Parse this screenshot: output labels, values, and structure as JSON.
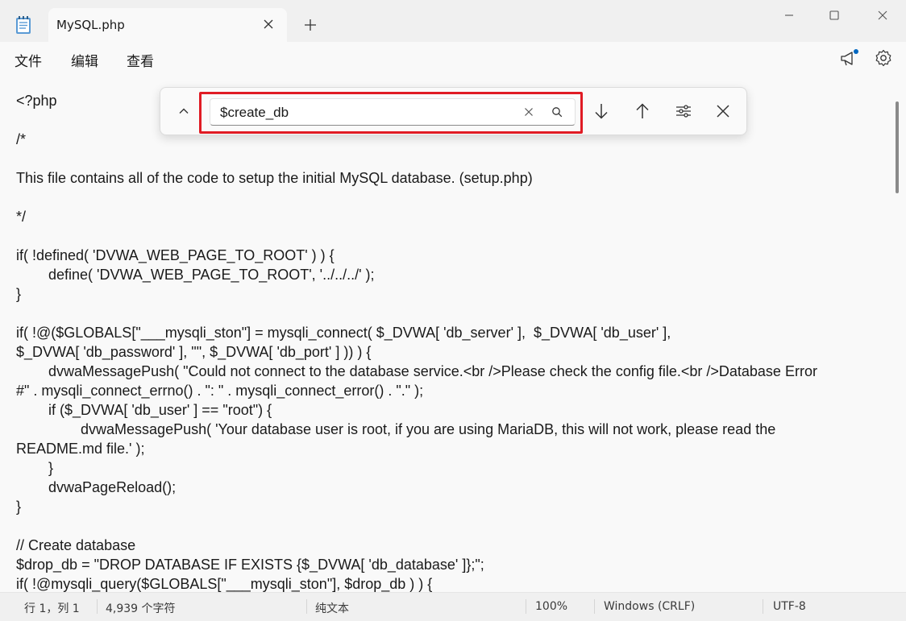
{
  "window": {
    "tab_title": "MySQL.php"
  },
  "menu": {
    "items": [
      {
        "label": "文件"
      },
      {
        "label": "编辑"
      },
      {
        "label": "查看"
      }
    ]
  },
  "find": {
    "value": "$create_db"
  },
  "editor": {
    "text": "<?php\n\n/*\n\nThis file contains all of the code to setup the initial MySQL database. (setup.php)\n\n*/\n\nif( !defined( 'DVWA_WEB_PAGE_TO_ROOT' ) ) {\n\tdefine( 'DVWA_WEB_PAGE_TO_ROOT', '../../../' );\n}\n\nif( !@($GLOBALS[\"___mysqli_ston\"] = mysqli_connect( $_DVWA[ 'db_server' ],  $_DVWA[ 'db_user' ],\n$_DVWA[ 'db_password' ], \"\", $_DVWA[ 'db_port' ] )) ) {\n\tdvwaMessagePush( \"Could not connect to the database service.<br />Please check the config file.<br />Database Error\n#\" . mysqli_connect_errno() . \": \" . mysqli_connect_error() . \".\" );\n\tif ($_DVWA[ 'db_user' ] == \"root\") {\n\t\tdvwaMessagePush( 'Your database user is root, if you are using MariaDB, this will not work, please read the\nREADME.md file.' );\n\t}\n\tdvwaPageReload();\n}\n\n// Create database\n$drop_db = \"DROP DATABASE IF EXISTS {$_DVWA[ 'db_database' ]};\";\nif( !@mysqli_query($GLOBALS[\"___mysqli_ston\"], $drop_db ) ) {"
  },
  "status": {
    "position": "行 1，列 1",
    "char_count": "4,939 个字符",
    "format": "纯文本",
    "zoom": "100%",
    "line_ending": "Windows (CRLF)",
    "encoding": "UTF-8"
  },
  "icons": {
    "app": "notepad-icon",
    "notification": "megaphone-icon",
    "settings": "gear-icon"
  },
  "colors": {
    "highlight": "#e01b24",
    "notification_dot": "#0067c0"
  }
}
